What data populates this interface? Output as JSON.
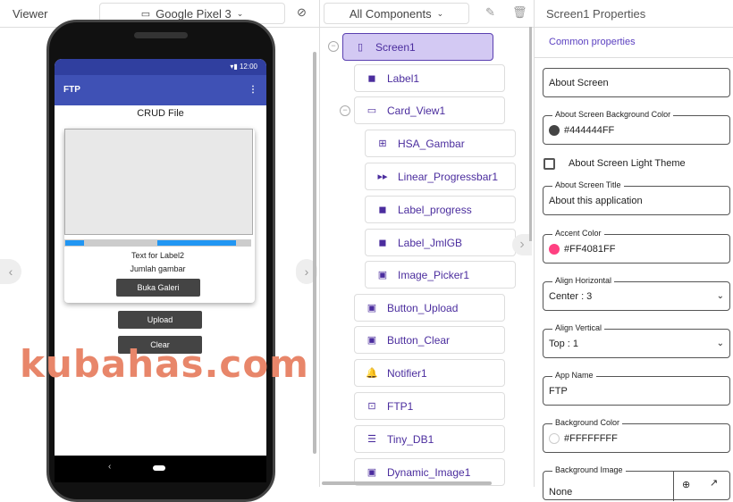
{
  "viewer": {
    "title": "Viewer",
    "device": "Google Pixel 3"
  },
  "tree": {
    "filter": "All Components",
    "nodes": [
      {
        "label": "Screen1",
        "icon": "phone-icon"
      },
      {
        "label": "Label1",
        "icon": "label-icon"
      },
      {
        "label": "Card_View1",
        "icon": "card-icon"
      },
      {
        "label": "HSA_Gambar",
        "icon": "hscroll-icon"
      },
      {
        "label": "Linear_Progressbar1",
        "icon": "progress-icon"
      },
      {
        "label": "Label_progress",
        "icon": "label-icon"
      },
      {
        "label": "Label_JmlGB",
        "icon": "label-icon"
      },
      {
        "label": "Image_Picker1",
        "icon": "image-icon"
      },
      {
        "label": "Button_Upload",
        "icon": "button-icon"
      },
      {
        "label": "Button_Clear",
        "icon": "button-icon"
      },
      {
        "label": "Notifier1",
        "icon": "bell-icon"
      },
      {
        "label": "FTP1",
        "icon": "ftp-icon"
      },
      {
        "label": "Tiny_DB1",
        "icon": "database-icon"
      },
      {
        "label": "Dynamic_Image1",
        "icon": "image-icon"
      }
    ]
  },
  "phone": {
    "time": "12:00",
    "app_title": "FTP",
    "heading": "CRUD File",
    "label2": "Text for Label2",
    "label_count": "Jumlah gambar",
    "btn_gallery": "Buka Galeri",
    "btn_upload": "Upload",
    "btn_clear": "Clear",
    "nav_back": "‹"
  },
  "props": {
    "title": "Screen1 Properties",
    "tab": "Common properties",
    "about_screen": "About Screen",
    "about_bg_label": "About Screen Background Color",
    "about_bg": "#444444FF",
    "light_theme": "About Screen Light Theme",
    "about_title_label": "About Screen Title",
    "about_title": "About this application",
    "accent_label": "Accent Color",
    "accent": "#FF4081FF",
    "align_h_label": "Align Horizontal",
    "align_h": "Center : 3",
    "align_v_label": "Align Vertical",
    "align_v": "Top : 1",
    "app_name_label": "App Name",
    "app_name": "FTP",
    "bg_label": "Background Color",
    "bg": "#FFFFFFFF",
    "bg_img_label": "Background Image",
    "bg_img": "None"
  },
  "watermark": "kubahas.com"
}
